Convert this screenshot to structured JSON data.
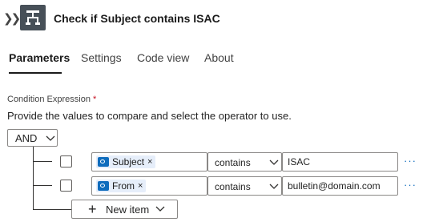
{
  "header": {
    "title": "Check if Subject contains ISAC"
  },
  "tabs": [
    {
      "label": "Parameters",
      "active": true
    },
    {
      "label": "Settings"
    },
    {
      "label": "Code view"
    },
    {
      "label": "About"
    }
  ],
  "condition": {
    "label": "Condition Expression",
    "required_mark": "*",
    "description": "Provide the values to compare and select the operator to use.",
    "group_operator": "AND",
    "rows": [
      {
        "field_token": "Subject",
        "operator": "contains",
        "value": "ISAC"
      },
      {
        "field_token": "From",
        "operator": "contains",
        "value": "bulletin@domain.com"
      }
    ],
    "new_item_label": "New item"
  },
  "icons": {
    "collapse": "double-chevron-right-icon",
    "action": "condition-icon",
    "token": "outlook-icon",
    "remove": "close-icon",
    "dropdown": "chevron-down-icon",
    "more": "ellipsis-icon",
    "add": "plus-icon"
  },
  "colors": {
    "accent": "#0f6cbd",
    "action_icon_bg": "#475058",
    "required": "#c50f1f",
    "token_bg": "#e6eefa"
  }
}
